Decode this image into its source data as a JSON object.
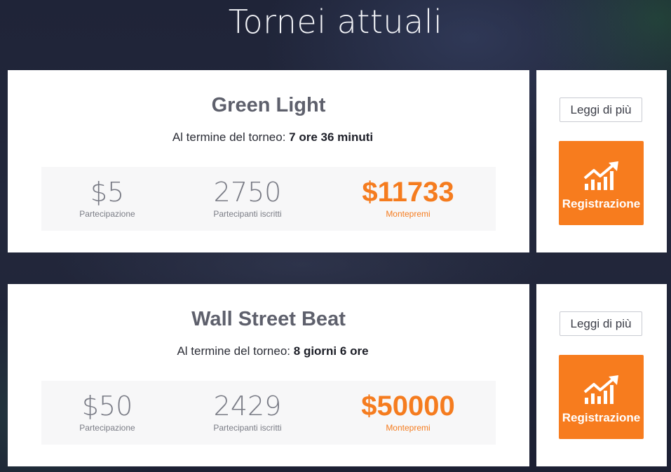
{
  "page": {
    "title": "Tornei attuali"
  },
  "tournaments": [
    {
      "name": "Green Light",
      "timer_label": "Al termine del torneo:",
      "timer_part1": "7 ore",
      "timer_part2": "36 minuti",
      "fee": "$5",
      "fee_label": "Partecipazione",
      "participants": "2750",
      "participants_label": "Partecipanti iscritti",
      "prize": "$11733",
      "prize_label": "Montepremi",
      "more_label": "Leggi di più",
      "register_label": "Registrazione",
      "register_icon": "chart-growth-icon"
    },
    {
      "name": "Wall Street Beat",
      "timer_label": "Al termine del torneo:",
      "timer_part1": "8 giorni",
      "timer_part2": "6 ore",
      "fee": "$50",
      "fee_label": "Partecipazione",
      "participants": "2429",
      "participants_label": "Partecipanti iscritti",
      "prize": "$50000",
      "prize_label": "Montepremi",
      "more_label": "Leggi di più",
      "register_label": "Registrazione",
      "register_icon": "chart-growth-icon"
    }
  ],
  "colors": {
    "accent": "#f77c1e",
    "background": "#21263a",
    "card": "#ffffff",
    "title_text": "#5e606c"
  }
}
